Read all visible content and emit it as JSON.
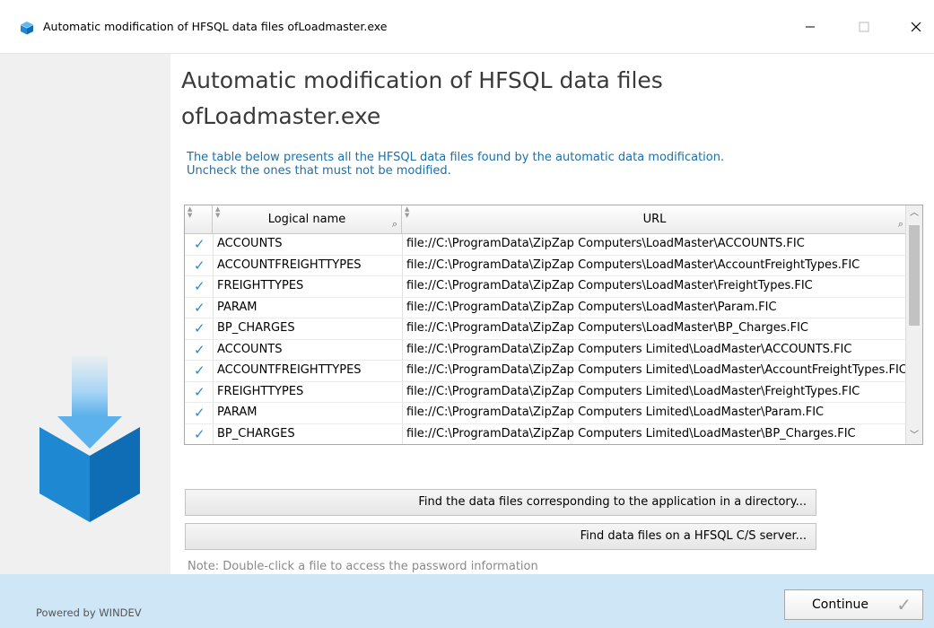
{
  "window": {
    "title": "Automatic modification of HFSQL data files ofLoadmaster.exe"
  },
  "heading": {
    "line1": "Automatic modification of HFSQL data files",
    "line2": "ofLoadmaster.exe"
  },
  "description": {
    "line1": "The table below presents all the HFSQL data files found by the automatic data modification.",
    "line2": "Uncheck the ones that must not be modified."
  },
  "table": {
    "columns": [
      "Logical name",
      "URL"
    ],
    "rows": [
      {
        "checked": true,
        "name": "ACCOUNTS",
        "url": "file://C:\\ProgramData\\ZipZap Computers\\LoadMaster\\ACCOUNTS.FIC"
      },
      {
        "checked": true,
        "name": "ACCOUNTFREIGHTTYPES",
        "url": "file://C:\\ProgramData\\ZipZap Computers\\LoadMaster\\AccountFreightTypes.FIC"
      },
      {
        "checked": true,
        "name": "FREIGHTTYPES",
        "url": "file://C:\\ProgramData\\ZipZap Computers\\LoadMaster\\FreightTypes.FIC"
      },
      {
        "checked": true,
        "name": "PARAM",
        "url": "file://C:\\ProgramData\\ZipZap Computers\\LoadMaster\\Param.FIC"
      },
      {
        "checked": true,
        "name": "BP_CHARGES",
        "url": "file://C:\\ProgramData\\ZipZap Computers\\LoadMaster\\BP_Charges.FIC"
      },
      {
        "checked": true,
        "name": "ACCOUNTS",
        "url": "file://C:\\ProgramData\\ZipZap Computers Limited\\LoadMaster\\ACCOUNTS.FIC"
      },
      {
        "checked": true,
        "name": "ACCOUNTFREIGHTTYPES",
        "url": "file://C:\\ProgramData\\ZipZap Computers Limited\\LoadMaster\\AccountFreightTypes.FIC"
      },
      {
        "checked": true,
        "name": "FREIGHTTYPES",
        "url": "file://C:\\ProgramData\\ZipZap Computers Limited\\LoadMaster\\FreightTypes.FIC"
      },
      {
        "checked": true,
        "name": "PARAM",
        "url": "file://C:\\ProgramData\\ZipZap Computers Limited\\LoadMaster\\Param.FIC"
      },
      {
        "checked": true,
        "name": "BP_CHARGES",
        "url": "file://C:\\ProgramData\\ZipZap Computers Limited\\LoadMaster\\BP_Charges.FIC"
      }
    ]
  },
  "buttons": {
    "find_directory": "Find the data files corresponding to the application in a directory...",
    "find_server": "Find data files on a HFSQL C/S server...",
    "continue": "Continue"
  },
  "note": "Note: Double-click a file to access the password information",
  "footer": {
    "powered_by": "Powered by WINDEV"
  },
  "colors": {
    "accent": "#1d6fa8",
    "footer_bg": "#cfe6f7",
    "check": "#2a8ad4"
  },
  "icons": [
    "app-icon",
    "minimize-icon",
    "maximize-icon",
    "close-icon",
    "search-icon",
    "sort-icon",
    "checkmark-icon",
    "scroll-up-icon",
    "scroll-down-icon",
    "install-box-icon"
  ]
}
